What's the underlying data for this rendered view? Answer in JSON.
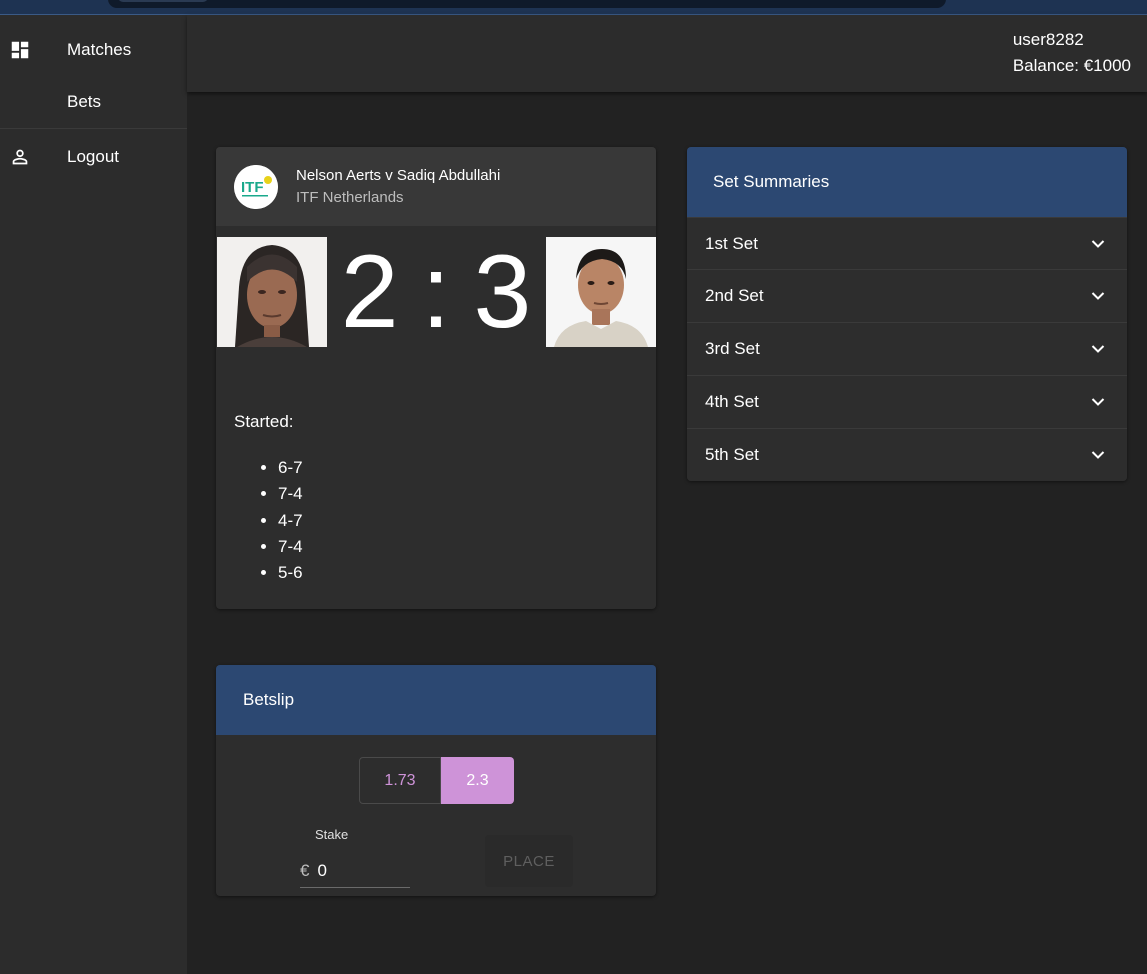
{
  "sidebar": {
    "items": [
      {
        "label": "Matches",
        "icon": "dashboard-icon"
      },
      {
        "label": "Bets",
        "icon": ""
      },
      {
        "label": "Logout",
        "icon": "person-icon"
      }
    ]
  },
  "header": {
    "username": "user8282",
    "balance": "Balance: €1000"
  },
  "match": {
    "title": "Nelson Aerts v Sadiq Abdullahi",
    "tournament": "ITF Netherlands",
    "logo_text": "ITF",
    "score_home": "2",
    "score_sep": ":",
    "score_away": "3",
    "status": "Started:",
    "sets": [
      "6-7",
      "7-4",
      "4-7",
      "7-4",
      "5-6"
    ]
  },
  "betslip": {
    "title": "Betslip",
    "odds": [
      "1.73",
      "2.3"
    ],
    "selected_odd_index": 1,
    "stake_label": "Stake",
    "currency": "€",
    "stake_value": "0",
    "place_label": "PLACE"
  },
  "set_summaries": {
    "title": "Set Summaries",
    "items": [
      "1st Set",
      "2nd Set",
      "3rd Set",
      "4th Set",
      "5th Set"
    ]
  },
  "colors": {
    "accent_blue": "#2c4872",
    "odd_accent": "#ce93d8",
    "background": "#222222",
    "surface": "#2d2d2d"
  }
}
